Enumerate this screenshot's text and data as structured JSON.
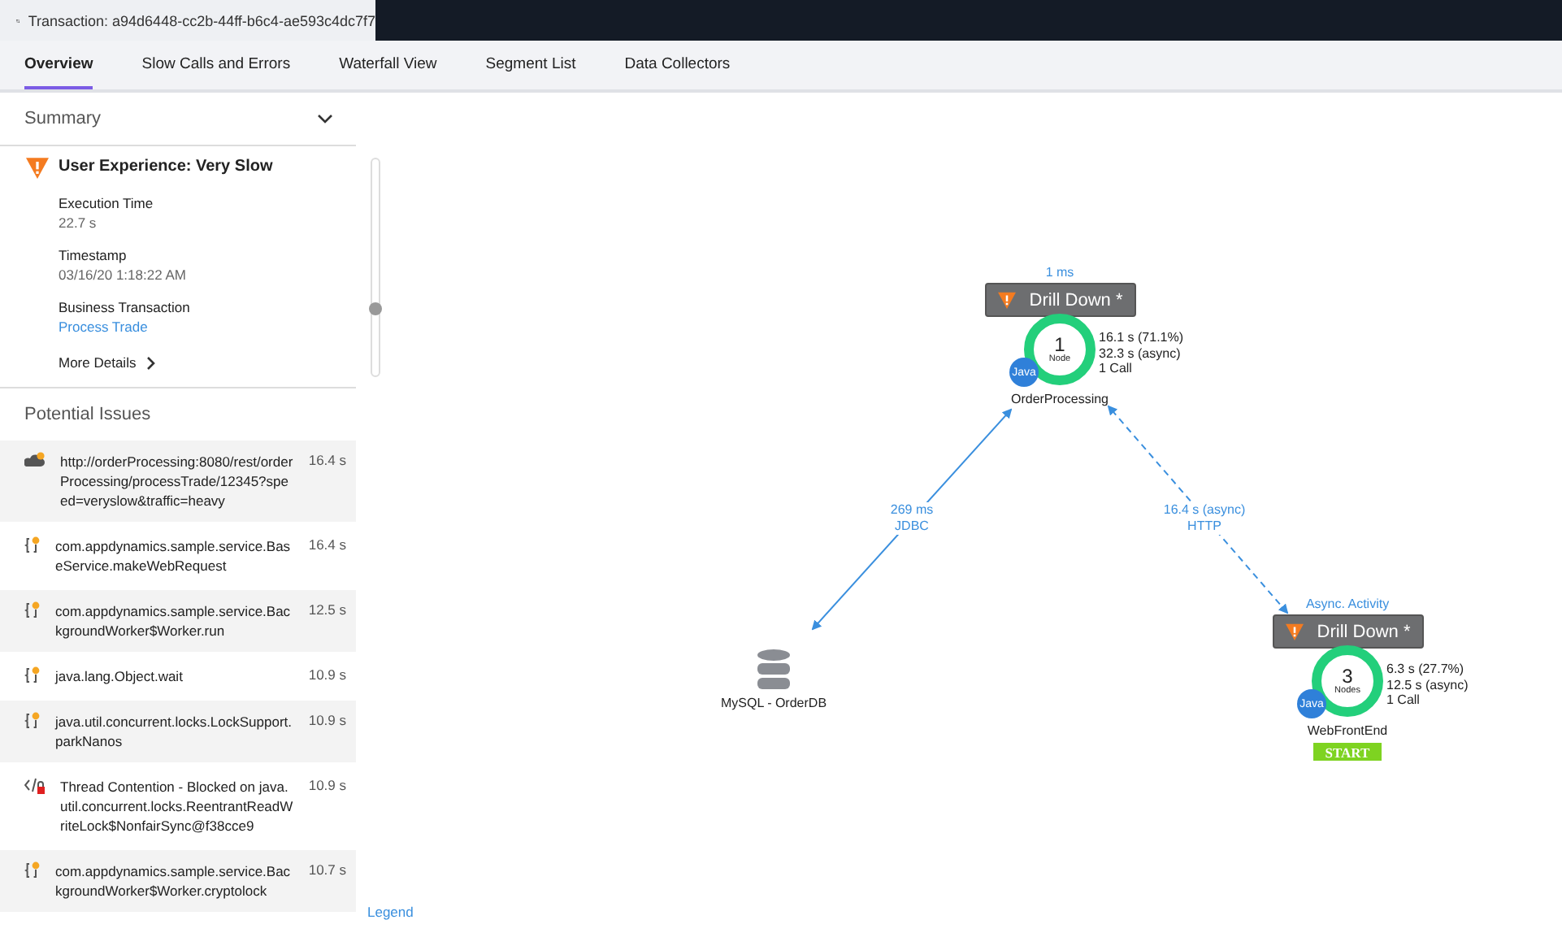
{
  "window": {
    "title": "Transaction: a94d6448-cc2b-44ff-b6c4-ae593c4dc7f7"
  },
  "tabs": [
    {
      "label": "Overview",
      "selected": true
    },
    {
      "label": "Slow Calls and Errors",
      "selected": false
    },
    {
      "label": "Waterfall View",
      "selected": false
    },
    {
      "label": "Segment List",
      "selected": false
    },
    {
      "label": "Data Collectors",
      "selected": false
    }
  ],
  "summary": {
    "title": "Summary",
    "expanded": true,
    "experience": "User Experience: Very Slow",
    "fields": [
      {
        "label": "Execution Time",
        "value": "22.7 s",
        "kind": "text"
      },
      {
        "label": "Timestamp",
        "value": "03/16/20 1:18:22 AM",
        "kind": "text"
      },
      {
        "label": "Business Transaction",
        "value": "Process Trade",
        "kind": "link"
      }
    ],
    "more": "More Details"
  },
  "potential_issues": {
    "title": "Potential Issues",
    "items": [
      {
        "kind": "web",
        "text": "http://orderProcessing:8080/rest/orderProcessing/processTrade/12345?speed=veryslow&traffic=heavy",
        "time": "16.4 s"
      },
      {
        "kind": "method",
        "text": "com.appdynamics.sample.service.BaseService.makeWebRequest",
        "time": "16.4 s"
      },
      {
        "kind": "method",
        "text": "com.appdynamics.sample.service.BackgroundWorker$Worker.run",
        "time": "12.5 s"
      },
      {
        "kind": "method",
        "text": "java.lang.Object.wait",
        "time": "10.9 s"
      },
      {
        "kind": "method",
        "text": "java.util.concurrent.locks.LockSupport.parkNanos",
        "time": "10.9 s"
      },
      {
        "kind": "lock",
        "text": "Thread Contention - Blocked on java.util.concurrent.locks.ReentrantReadWriteLock$NonfairSync@f38cce9",
        "time": "10.9 s"
      },
      {
        "kind": "method",
        "text": "com.appdynamics.sample.service.BackgroundWorker$Worker.cryptolock",
        "time": "10.7 s"
      }
    ]
  },
  "flow_map": {
    "nodes": [
      {
        "count": "1",
        "unit": "Node",
        "name": "OrderProcessing",
        "badge": "Java",
        "drill": "Drill Down *",
        "above": "1 ms",
        "stats": [
          "16.1 s (71.1%)",
          "32.3 s (async)",
          "1 Call"
        ]
      },
      {
        "count": "3",
        "unit": "Nodes",
        "name": "WebFrontEnd",
        "badge": "Java",
        "drill": "Drill Down *",
        "above": "Async. Activity",
        "stats": [
          "6.3 s (27.7%)",
          "12.5 s (async)",
          "1 Call"
        ],
        "start": "START"
      }
    ],
    "database": {
      "name": "MySQL - OrderDB"
    },
    "edges": [
      {
        "kind": "sync",
        "lines": [
          "269 ms",
          "JDBC"
        ]
      },
      {
        "kind": "async",
        "lines": [
          "16.4 s (async)",
          "HTTP"
        ]
      }
    ],
    "legend": "Legend"
  }
}
